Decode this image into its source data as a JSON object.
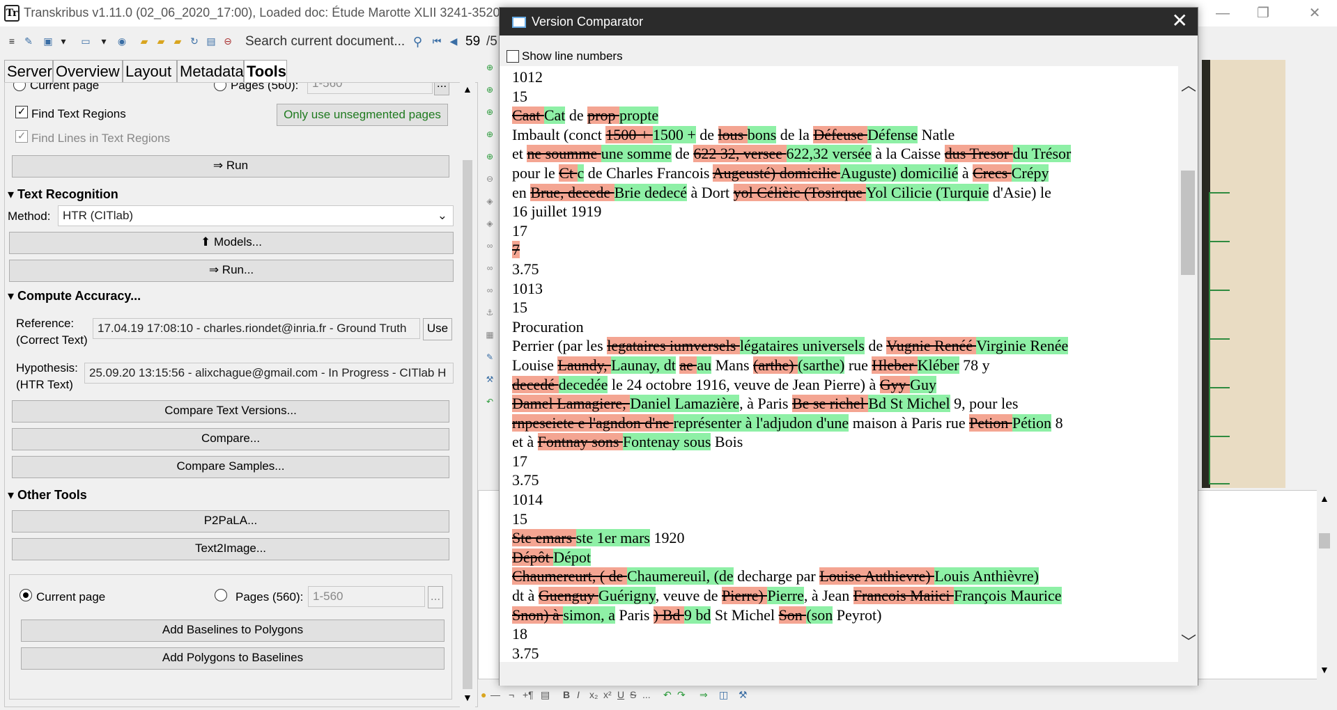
{
  "app": {
    "title": "Transkribus v1.11.0 (02_06_2020_17:00), Loaded doc: Étude Marotte XLII 3241-3520 jar",
    "logo_text": "Tr"
  },
  "toolbar": {
    "search_placeholder": "Search current document...",
    "page_current": "59",
    "page_total": "/5"
  },
  "tabs": [
    {
      "label": "Server"
    },
    {
      "label": "Overview"
    },
    {
      "label": "Layout"
    },
    {
      "label": "Metadata"
    },
    {
      "label": "Tools",
      "active": true
    }
  ],
  "tools": {
    "partial_top": {
      "current_page": "Current page",
      "pages": "Pages (560):",
      "pages_value": "1-560"
    },
    "find_text_regions": {
      "label": "Find Text Regions",
      "checked": true
    },
    "only_unsegmented": "Only use unsegmented pages",
    "find_lines": {
      "label": "Find Lines in Text Regions",
      "checked": true
    },
    "run_layout": "⇒ Run",
    "text_recognition": {
      "title": "Text Recognition",
      "method_label": "Method:",
      "method_value": "HTR (CITlab)",
      "models_button": "Models...",
      "run_button": "⇒ Run..."
    },
    "compute_accuracy": {
      "title": "Compute Accuracy...",
      "reference_label": "Reference:",
      "reference_sub": "(Correct Text)",
      "reference_value": "17.04.19 17:08:10 - charles.riondet@inria.fr - Ground Truth",
      "use_button": "Use",
      "hypothesis_label": "Hypothesis:",
      "hypothesis_sub": "(HTR Text)",
      "hypothesis_value": "25.09.20 13:15:56 - alixchague@gmail.com - In Progress - CITlab H",
      "compare_text_versions": "Compare Text Versions...",
      "compare": "Compare...",
      "compare_samples": "Compare Samples..."
    },
    "other_tools": {
      "title": "Other Tools",
      "p2pala": "P2PaLA...",
      "text2image": "Text2Image...",
      "current_page": "Current page",
      "pages_label": "Pages (560):",
      "pages_value": "1-560",
      "pages_more": "...",
      "add_baselines": "Add Baselines to Polygons",
      "add_polygons": "Add Polygons to Baselines"
    }
  },
  "dialog": {
    "title": "Version Comparator",
    "show_line_numbers": "Show line numbers",
    "lines": [
      [
        {
          "t": "1012",
          "k": "n"
        }
      ],
      [
        {
          "t": "15",
          "k": "n"
        }
      ],
      [
        {
          "t": "Caat ",
          "k": "d"
        },
        {
          "t": "Cat",
          "k": "i"
        },
        {
          "t": " de ",
          "k": "n"
        },
        {
          "t": "prop ",
          "k": "d"
        },
        {
          "t": "propte",
          "k": "i"
        }
      ],
      [
        {
          "t": "Imbault (conct ",
          "k": "n"
        },
        {
          "t": "1500 + ",
          "k": "d"
        },
        {
          "t": "1500 +",
          "k": "i"
        },
        {
          "t": " de ",
          "k": "n"
        },
        {
          "t": "lous ",
          "k": "d"
        },
        {
          "t": "bons",
          "k": "i"
        },
        {
          "t": " de la ",
          "k": "n"
        },
        {
          "t": "Défeuse ",
          "k": "d"
        },
        {
          "t": "Défense",
          "k": "i"
        },
        {
          "t": " Natle",
          "k": "n"
        }
      ],
      [
        {
          "t": "et ",
          "k": "n"
        },
        {
          "t": "ne soumme ",
          "k": "d"
        },
        {
          "t": "une somme",
          "k": "i"
        },
        {
          "t": " de ",
          "k": "n"
        },
        {
          "t": "622 32, versee ",
          "k": "d"
        },
        {
          "t": "622,32 versée",
          "k": "i"
        },
        {
          "t": " à la Caisse ",
          "k": "n"
        },
        {
          "t": "dus Tresor ",
          "k": "d"
        },
        {
          "t": "du Trésor",
          "k": "i"
        }
      ],
      [
        {
          "t": "pour le ",
          "k": "n"
        },
        {
          "t": "Ct ",
          "k": "d"
        },
        {
          "t": "c",
          "k": "i"
        },
        {
          "t": " de Charles Francois ",
          "k": "n"
        },
        {
          "t": "Augeusté) domicilie ",
          "k": "d"
        },
        {
          "t": "Auguste) domicilié",
          "k": "i"
        },
        {
          "t": " à ",
          "k": "n"
        },
        {
          "t": "Crecs ",
          "k": "d"
        },
        {
          "t": "Crépy",
          "k": "i"
        }
      ],
      [
        {
          "t": "en ",
          "k": "n"
        },
        {
          "t": "Brue, decede ",
          "k": "d"
        },
        {
          "t": "Brie dedecé",
          "k": "i"
        },
        {
          "t": " à Dort ",
          "k": "n"
        },
        {
          "t": "yol Célièic (Tosirque ",
          "k": "d"
        },
        {
          "t": "Yol Cilicie (Turquie",
          "k": "i"
        },
        {
          "t": " d'Asie) le",
          "k": "n"
        }
      ],
      [
        {
          "t": "16 juillet 1919",
          "k": "n"
        }
      ],
      [
        {
          "t": "17",
          "k": "n"
        }
      ],
      [
        {
          "t": "7",
          "k": "d"
        }
      ],
      [
        {
          "t": "3.75",
          "k": "n"
        }
      ],
      [
        {
          "t": "1013",
          "k": "n"
        }
      ],
      [
        {
          "t": "15",
          "k": "n"
        }
      ],
      [
        {
          "t": "Procuration",
          "k": "n"
        }
      ],
      [
        {
          "t": "Perrier (par les ",
          "k": "n"
        },
        {
          "t": "legataires iumversels ",
          "k": "d"
        },
        {
          "t": "légataires universels",
          "k": "i"
        },
        {
          "t": " de ",
          "k": "n"
        },
        {
          "t": "Vugnie Renéé ",
          "k": "d"
        },
        {
          "t": "Virginie Renée",
          "k": "i"
        }
      ],
      [
        {
          "t": "Louise ",
          "k": "n"
        },
        {
          "t": "Laundy, ",
          "k": "d"
        },
        {
          "t": "Launay, dt",
          "k": "i"
        },
        {
          "t": " ",
          "k": "n"
        },
        {
          "t": "ae ",
          "k": "d"
        },
        {
          "t": "au",
          "k": "i"
        },
        {
          "t": " Mans ",
          "k": "n"
        },
        {
          "t": "(arthe) ",
          "k": "d"
        },
        {
          "t": "(sarthe)",
          "k": "i"
        },
        {
          "t": " rue ",
          "k": "n"
        },
        {
          "t": "Hleber ",
          "k": "d"
        },
        {
          "t": "Kléber",
          "k": "i"
        },
        {
          "t": " 78 y",
          "k": "n"
        }
      ],
      [
        {
          "t": "decedé ",
          "k": "d"
        },
        {
          "t": "decedée",
          "k": "i"
        },
        {
          "t": " le 24 octobre 1916, veuve de Jean Pierre) à ",
          "k": "n"
        },
        {
          "t": "Gyy ",
          "k": "d"
        },
        {
          "t": "Guy",
          "k": "i"
        }
      ],
      [
        {
          "t": "Damel Lamagiere, ",
          "k": "d"
        },
        {
          "t": "Daniel Lamazière",
          "k": "i"
        },
        {
          "t": ", à Paris ",
          "k": "n"
        },
        {
          "t": "Be se richel ",
          "k": "d"
        },
        {
          "t": "Bd St Michel",
          "k": "i"
        },
        {
          "t": " 9, pour les",
          "k": "n"
        }
      ],
      [
        {
          "t": "rnpeseiete e l'agndon d'ne ",
          "k": "d"
        },
        {
          "t": "représenter à l'adjudon d'une",
          "k": "i"
        },
        {
          "t": " maison à Paris rue ",
          "k": "n"
        },
        {
          "t": "Petion ",
          "k": "d"
        },
        {
          "t": "Pétion",
          "k": "i"
        },
        {
          "t": " 8",
          "k": "n"
        }
      ],
      [
        {
          "t": "et à ",
          "k": "n"
        },
        {
          "t": "Fontnay sons ",
          "k": "d"
        },
        {
          "t": "Fontenay sous",
          "k": "i"
        },
        {
          "t": " Bois",
          "k": "n"
        }
      ],
      [
        {
          "t": "17",
          "k": "n"
        }
      ],
      [
        {
          "t": "3.75",
          "k": "n"
        }
      ],
      [
        {
          "t": "1014",
          "k": "n"
        }
      ],
      [
        {
          "t": "15",
          "k": "n"
        }
      ],
      [
        {
          "t": "Ste emars ",
          "k": "d"
        },
        {
          "t": "ste 1er mars",
          "k": "i"
        },
        {
          "t": " 1920",
          "k": "n"
        }
      ],
      [
        {
          "t": "Dépôt ",
          "k": "d"
        },
        {
          "t": "Dépot",
          "k": "i"
        }
      ],
      [
        {
          "t": "Chaumereurt, ( de ",
          "k": "d"
        },
        {
          "t": "Chaumereuil, (de",
          "k": "i"
        },
        {
          "t": " decharge par ",
          "k": "n"
        },
        {
          "t": "Louise Authievre) ",
          "k": "d"
        },
        {
          "t": "Louis Anthièvre)",
          "k": "i"
        }
      ],
      [
        {
          "t": "dt à ",
          "k": "n"
        },
        {
          "t": "Guenguy ",
          "k": "d"
        },
        {
          "t": "Guérigny",
          "k": "i"
        },
        {
          "t": ", veuve de ",
          "k": "n"
        },
        {
          "t": "Pierre) ",
          "k": "d"
        },
        {
          "t": "Pierre",
          "k": "i"
        },
        {
          "t": ", à Jean ",
          "k": "n"
        },
        {
          "t": "Francois Maiici ",
          "k": "d"
        },
        {
          "t": "François Maurice",
          "k": "i"
        }
      ],
      [
        {
          "t": "Snon) à ",
          "k": "d"
        },
        {
          "t": "simon, a",
          "k": "i"
        },
        {
          "t": " Paris ",
          "k": "n"
        },
        {
          "t": ") Bd ",
          "k": "d"
        },
        {
          "t": "9 bd",
          "k": "i"
        },
        {
          "t": " St Michel ",
          "k": "n"
        },
        {
          "t": "Son ",
          "k": "d"
        },
        {
          "t": "(son",
          "k": "i"
        },
        {
          "t": " Peyrot)",
          "k": "n"
        }
      ],
      [
        {
          "t": "18",
          "k": "n"
        }
      ],
      [
        {
          "t": "3.75",
          "k": "n"
        }
      ]
    ]
  },
  "colors": {
    "deleted_bg": "#f4a592",
    "inserted_bg": "#8ef0a6"
  }
}
